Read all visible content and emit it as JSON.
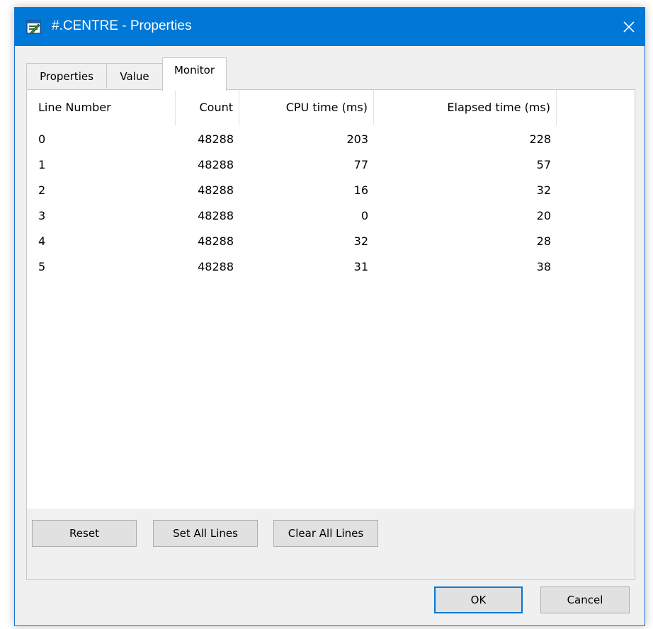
{
  "window": {
    "title": "#.CENTRE - Properties"
  },
  "tabs": [
    {
      "label": "Properties",
      "active": false
    },
    {
      "label": "Value",
      "active": false
    },
    {
      "label": "Monitor",
      "active": true
    }
  ],
  "monitor": {
    "columns": [
      "Line Number",
      "Count",
      "CPU time (ms)",
      "Elapsed time (ms)"
    ],
    "rows": [
      [
        "0",
        "48288",
        "203",
        "228"
      ],
      [
        "1",
        "48288",
        "77",
        "57"
      ],
      [
        "2",
        "48288",
        "16",
        "32"
      ],
      [
        "3",
        "48288",
        "0",
        "20"
      ],
      [
        "4",
        "48288",
        "32",
        "28"
      ],
      [
        "5",
        "48288",
        "31",
        "38"
      ]
    ],
    "buttons": {
      "reset": "Reset",
      "set_all": "Set All Lines",
      "clear_all": "Clear All Lines"
    }
  },
  "footer": {
    "ok": "OK",
    "cancel": "Cancel"
  },
  "colors": {
    "titlebar": "#0078d7",
    "dialog_bg": "#f0f0f0",
    "button_face": "#e1e1e1"
  },
  "icons": {
    "app": "properties-window-icon",
    "close": "close-icon"
  }
}
